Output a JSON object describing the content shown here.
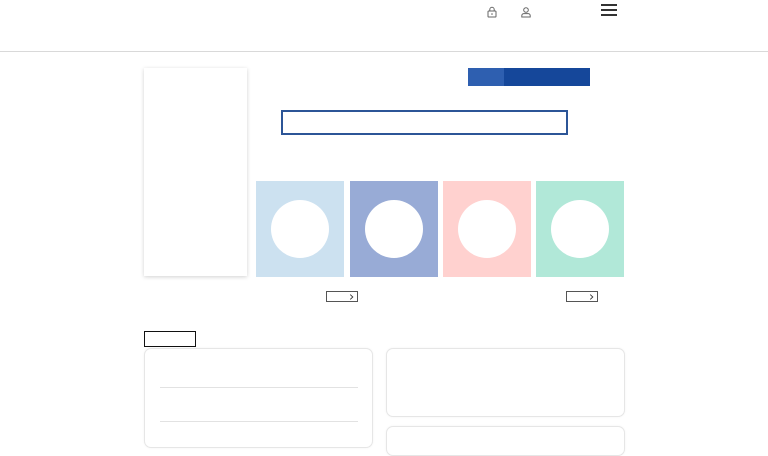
{
  "header": {
    "icons": [
      "lock-icon",
      "user-icon",
      "menu-icon"
    ]
  },
  "hero": {
    "search": {
      "value": "",
      "placeholder": ""
    },
    "cta_label": ""
  },
  "tiles": [
    {
      "color": "#cce1f0"
    },
    {
      "color": "#98abd6"
    },
    {
      "color": "#ffd1cf"
    },
    {
      "color": "#b1e8d8"
    }
  ],
  "colors": {
    "accent": "#15479a",
    "accent_light": "#2e5fb0",
    "input_border": "#2c5597"
  }
}
